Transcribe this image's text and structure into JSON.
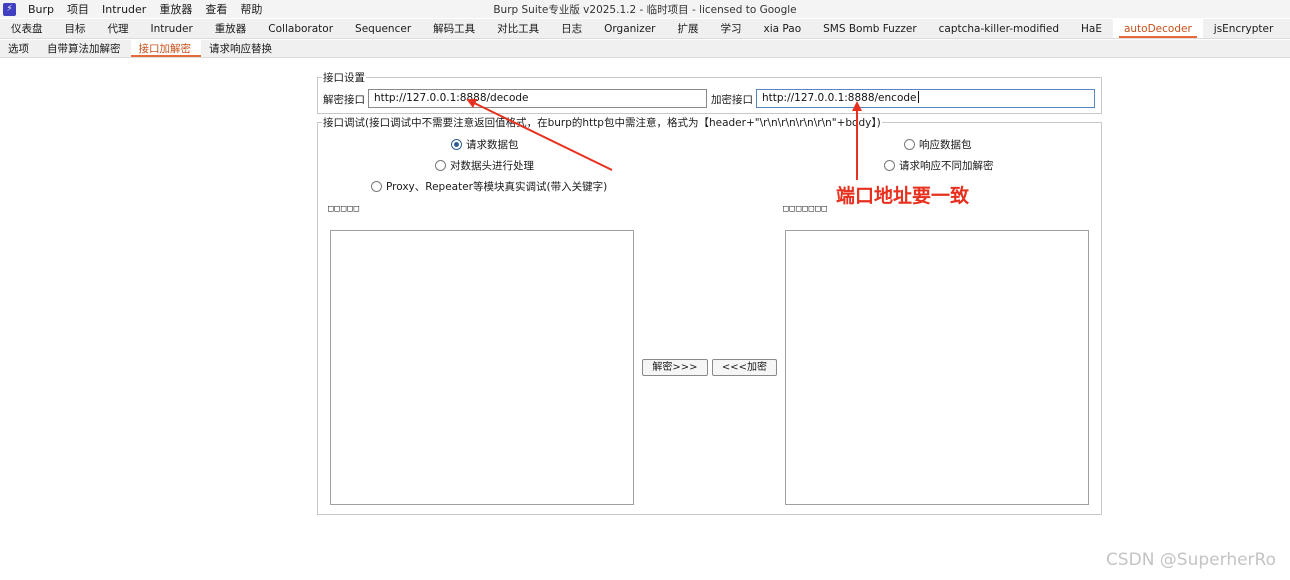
{
  "app": {
    "logo_glyph": "⚡",
    "window_title": "Burp Suite专业版  v2025.1.2 - 临时项目 - licensed to Google"
  },
  "menubar": {
    "items": [
      "Burp",
      "项目",
      "Intruder",
      "重放器",
      "查看",
      "帮助"
    ]
  },
  "main_tabs": {
    "items": [
      "仪表盘",
      "目标",
      "代理",
      "Intruder",
      "重放器",
      "Collaborator",
      "Sequencer",
      "解码工具",
      "对比工具",
      "日志",
      "Organizer",
      "扩展",
      "学习",
      "xia Pao",
      "SMS Bomb Fuzzer",
      "captcha-killer-modified",
      "HaE",
      "autoDecoder",
      "jsEncrypter"
    ],
    "active": "autoDecoder"
  },
  "sub_tabs": {
    "items": [
      "选项",
      "自带算法加解密",
      "接口加解密",
      "请求响应替换"
    ],
    "active": "接口加解密"
  },
  "interface_settings": {
    "title": "接口设置",
    "decode_label": "解密接口",
    "decode_value": "http://127.0.0.1:8888/decode",
    "encode_label": "加密接口",
    "encode_value": "http://127.0.0.1:8888/encode"
  },
  "interface_debug": {
    "title": "接口调试(接口调试中不需要注意返回值格式，在burp的http包中需注意，格式为【header+\"\\r\\n\\r\\n\\r\\n\\r\\n\"+body】)",
    "left_radios": [
      {
        "label": "请求数据包",
        "checked": true
      },
      {
        "label": "对数据头进行处理",
        "checked": false
      },
      {
        "label": "Proxy、Repeater等模块真实调试(带入关键字)",
        "checked": false
      }
    ],
    "right_radios": [
      {
        "label": "响应数据包",
        "checked": false
      },
      {
        "label": "请求响应不同加解密",
        "checked": false
      }
    ],
    "left_caption": "□□□□□",
    "right_caption": "□□□□□□□",
    "decrypt_button": "解密>>>",
    "encrypt_button": "<<<加密"
  },
  "annotation": {
    "text": "端口地址要一致",
    "color": "#e8301e"
  },
  "watermark": "CSDN @SuperherRo"
}
